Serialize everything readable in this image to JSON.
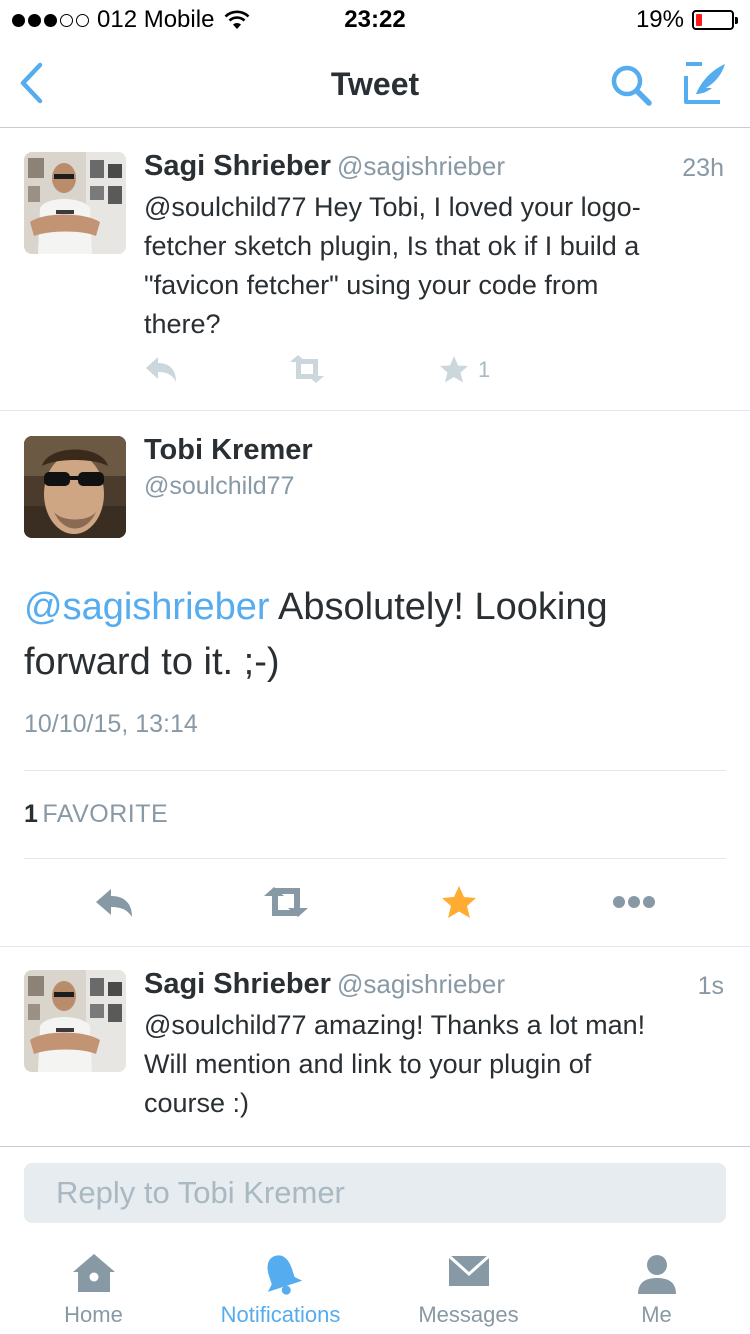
{
  "status": {
    "carrier": "012 Mobile",
    "time": "23:22",
    "battery": "19%",
    "battery_level": 0.19
  },
  "nav": {
    "title": "Tweet"
  },
  "tweets": [
    {
      "name": "Sagi Shrieber",
      "handle": "@sagishrieber",
      "time": "23h",
      "lines": [
        "@soulchild77 Hey Tobi, I loved your logo-",
        "fetcher sketch plugin, Is that ok if I build a",
        "\"favicon fetcher\" using your code from",
        "there?"
      ],
      "favorites": "1"
    }
  ],
  "main": {
    "name": "Tobi Kremer",
    "handle": "@soulchild77",
    "mention": "@sagishrieber",
    "text_line1": " Absolutely! Looking",
    "text_line2": "forward to it. ;-)",
    "date": "10/10/15, 13:14",
    "fav_count": "1",
    "fav_label": "FAVORITE",
    "accent": "#55acee",
    "star_color": "#ffac33"
  },
  "reply_tweet": {
    "name": "Sagi Shrieber",
    "handle": "@sagishrieber",
    "time": "1s",
    "lines": [
      "@soulchild77 amazing! Thanks a lot man!",
      "Will mention and link to your plugin of",
      "course :)"
    ]
  },
  "reply_box": {
    "placeholder": "Reply to Tobi Kremer"
  },
  "tabs": [
    {
      "label": "Home",
      "icon": "home-icon"
    },
    {
      "label": "Notifications",
      "icon": "bell-icon",
      "active": true
    },
    {
      "label": "Messages",
      "icon": "envelope-icon"
    },
    {
      "label": "Me",
      "icon": "person-icon"
    }
  ]
}
